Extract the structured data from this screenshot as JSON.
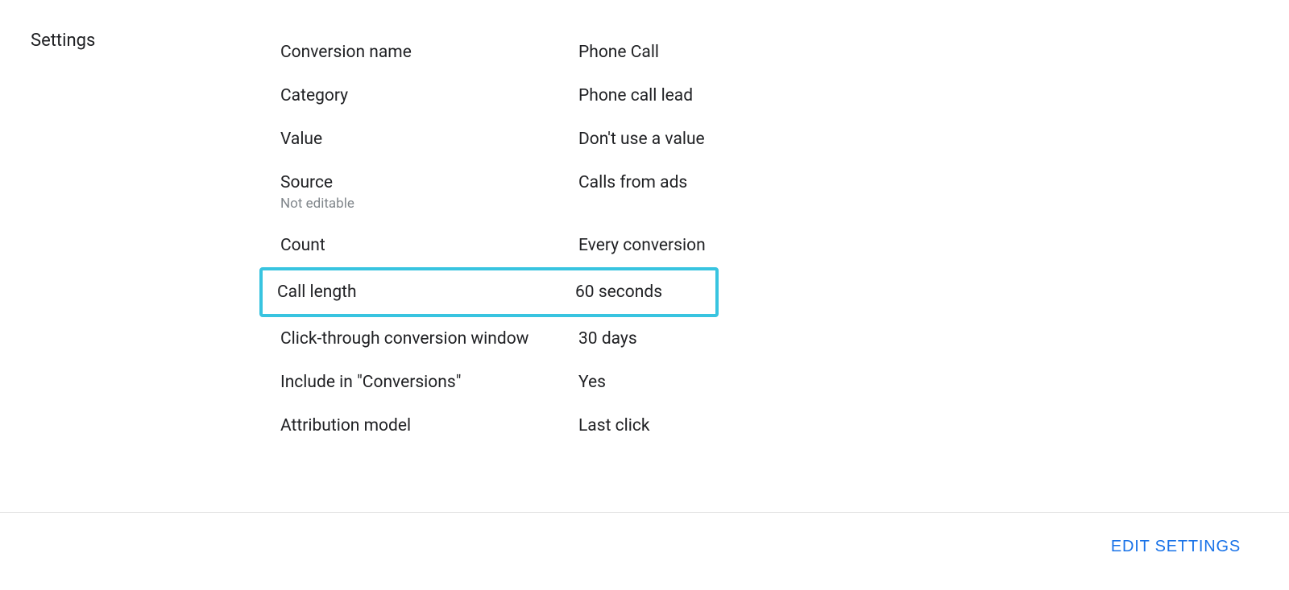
{
  "sidebar": {
    "title": "Settings"
  },
  "settings": {
    "rows": [
      {
        "label": "Conversion name",
        "sublabel": "",
        "value": "Phone Call",
        "highlighted": false
      },
      {
        "label": "Category",
        "sublabel": "",
        "value": "Phone call lead",
        "highlighted": false
      },
      {
        "label": "Value",
        "sublabel": "",
        "value": "Don't use a value",
        "highlighted": false
      },
      {
        "label": "Source",
        "sublabel": "Not editable",
        "value": "Calls from ads",
        "highlighted": false
      },
      {
        "label": "Count",
        "sublabel": "",
        "value": "Every conversion",
        "highlighted": false
      },
      {
        "label": "Call length",
        "sublabel": "",
        "value": "60 seconds",
        "highlighted": true
      },
      {
        "label": "Click-through conversion window",
        "sublabel": "",
        "value": "30 days",
        "highlighted": false
      },
      {
        "label": "Include in \"Conversions\"",
        "sublabel": "",
        "value": "Yes",
        "highlighted": false
      },
      {
        "label": "Attribution model",
        "sublabel": "",
        "value": "Last click",
        "highlighted": false
      }
    ]
  },
  "actions": {
    "edit_label": "EDIT SETTINGS"
  }
}
